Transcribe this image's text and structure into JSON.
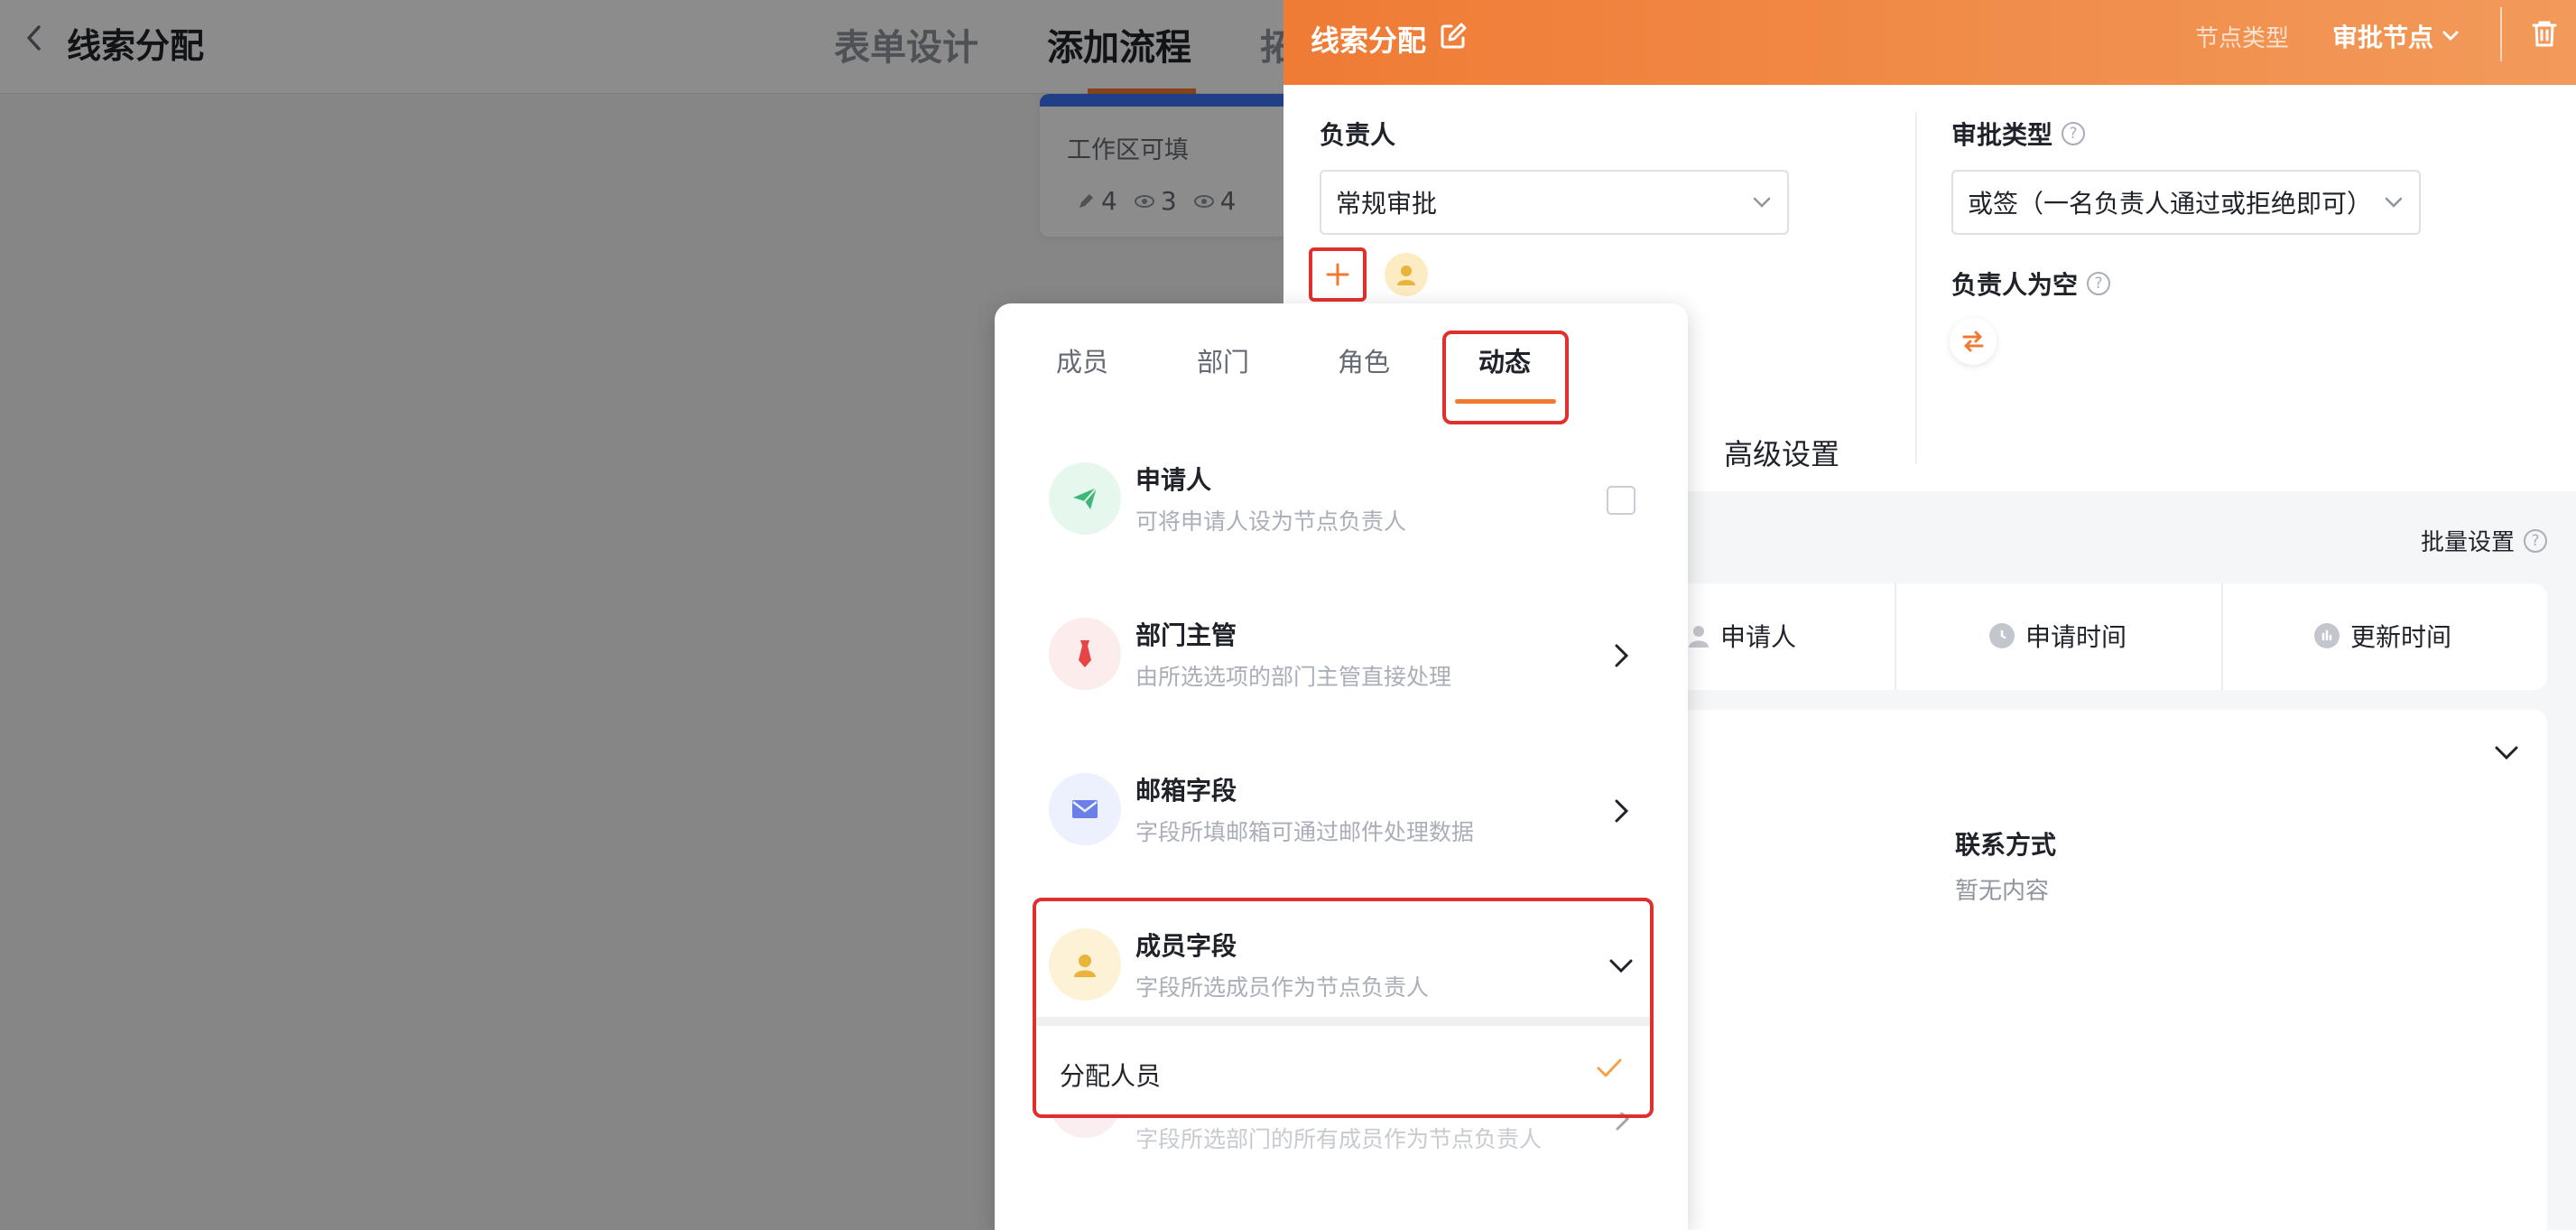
{
  "page": {
    "title": "线索分配",
    "tabs": [
      {
        "label": "表单设计"
      },
      {
        "label": "添加流程"
      },
      {
        "label": "拓"
      }
    ]
  },
  "flow_card": {
    "label": "工作区可填",
    "stats": [
      "4",
      "3",
      "4"
    ]
  },
  "drawer": {
    "title": "线索分配",
    "node_type_label": "节点类型",
    "node_type_value": "审批节点",
    "assignee_label": "负责人",
    "assignee_select": "常规审批",
    "approval_type_label": "审批类型",
    "approval_type_select": "或签（一名负责人通过或拒绝即可）",
    "empty_assignee_label": "负责人为空",
    "advanced_tab": "高级设置",
    "batch_setting": "批量设置",
    "columns": [
      "申请人",
      "申请时间",
      "更新时间"
    ],
    "contact_label": "联系方式",
    "contact_value": "暂无内容"
  },
  "popover": {
    "tabs": [
      "成员",
      "部门",
      "角色",
      "动态"
    ],
    "active_tab_index": 3,
    "options": [
      {
        "title": "申请人",
        "desc": "可将申请人设为节点负责人",
        "icon": "send-icon",
        "color": "#3cb878",
        "bg": "#e6f8ee"
      },
      {
        "title": "部门主管",
        "desc": "由所选选项的部门主管直接处理",
        "icon": "tie-icon",
        "color": "#e64545",
        "bg": "#fdecec"
      },
      {
        "title": "邮箱字段",
        "desc": "字段所填邮箱可通过邮件处理数据",
        "icon": "mail-icon",
        "color": "#6b7fe8",
        "bg": "#edf0fd"
      },
      {
        "title": "成员字段",
        "desc": "字段所选成员作为节点负责人",
        "icon": "user-icon",
        "color": "#e8b43a",
        "bg": "#fdf2d6"
      }
    ],
    "member_sub_option": "分配人员",
    "hidden_option_desc": "字段所选部门的所有成员作为节点负责人"
  },
  "colors": {
    "accent": "#f07a32",
    "highlight_border": "#e0302e"
  }
}
